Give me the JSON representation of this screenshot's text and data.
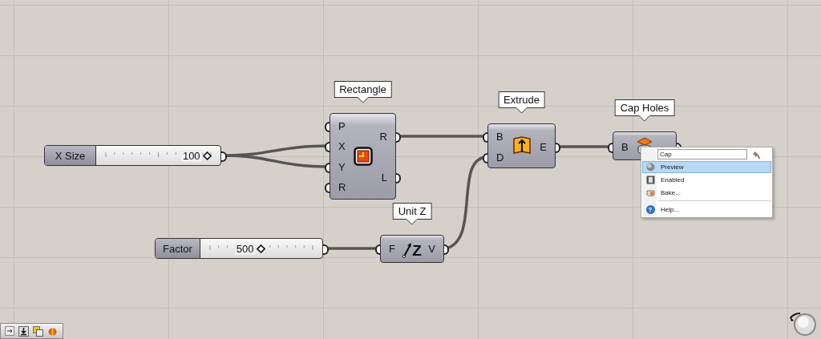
{
  "sliders": [
    {
      "label": "X Size",
      "value": "100"
    },
    {
      "label": "Factor",
      "value": "500"
    }
  ],
  "components": [
    {
      "tooltip": "Rectangle",
      "inputs": [
        "P",
        "X",
        "Y",
        "R"
      ],
      "outputs": [
        "R",
        "L"
      ]
    },
    {
      "tooltip": "Extrude",
      "inputs": [
        "B",
        "D"
      ],
      "outputs": [
        "E"
      ]
    },
    {
      "tooltip": "Unit Z",
      "inputs": [
        "F"
      ],
      "outputs": [
        "V"
      ],
      "icon_glyph": "Z"
    },
    {
      "tooltip": "Cap Holes",
      "inputs": [
        "B"
      ]
    }
  ],
  "context_menu": {
    "name_field": {
      "value": "Cap"
    },
    "items": [
      {
        "label": "Preview",
        "selected": true
      },
      {
        "label": "Enabled",
        "selected": false
      },
      {
        "label": "Bake...",
        "selected": false
      },
      {
        "label": "Help...",
        "selected": false,
        "icon_glyph": "?"
      }
    ]
  }
}
